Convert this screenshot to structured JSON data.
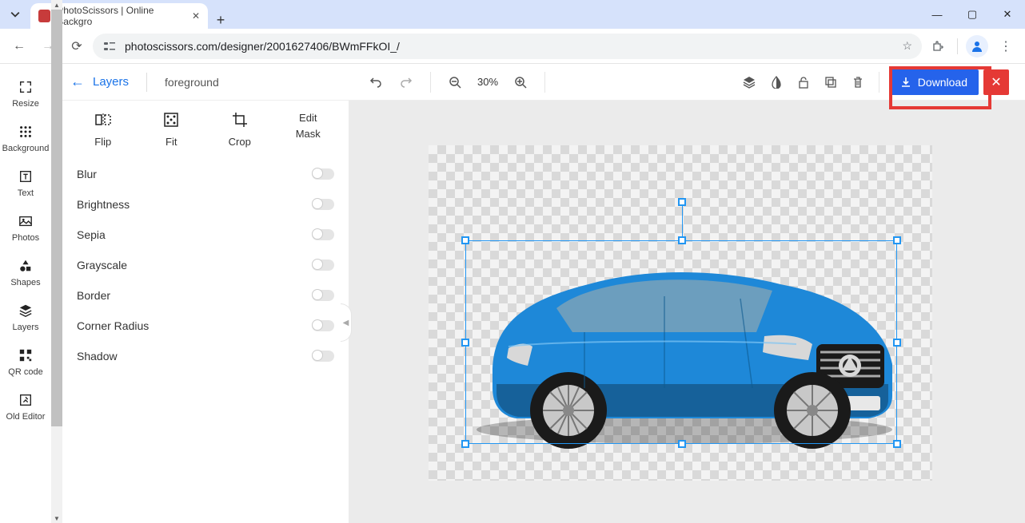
{
  "browser": {
    "tab_title": "PhotoScissors | Online Backgro",
    "url": "photoscissors.com/designer/2001627406/BWmFFkOI_/"
  },
  "left_rail": {
    "items": [
      {
        "label": "Resize"
      },
      {
        "label": "Background"
      },
      {
        "label": "Text"
      },
      {
        "label": "Photos"
      },
      {
        "label": "Shapes"
      },
      {
        "label": "Layers"
      },
      {
        "label": "QR code"
      },
      {
        "label": "Old Editor"
      }
    ]
  },
  "panel": {
    "back_label": "Layers",
    "current": "foreground",
    "tools": {
      "flip": "Flip",
      "fit": "Fit",
      "crop": "Crop",
      "edit_mask_l1": "Edit",
      "edit_mask_l2": "Mask"
    },
    "options": [
      {
        "label": "Blur"
      },
      {
        "label": "Brightness"
      },
      {
        "label": "Sepia"
      },
      {
        "label": "Grayscale"
      },
      {
        "label": "Border"
      },
      {
        "label": "Corner Radius"
      },
      {
        "label": "Shadow"
      }
    ]
  },
  "toolbar": {
    "zoom": "30%",
    "download": "Download"
  }
}
